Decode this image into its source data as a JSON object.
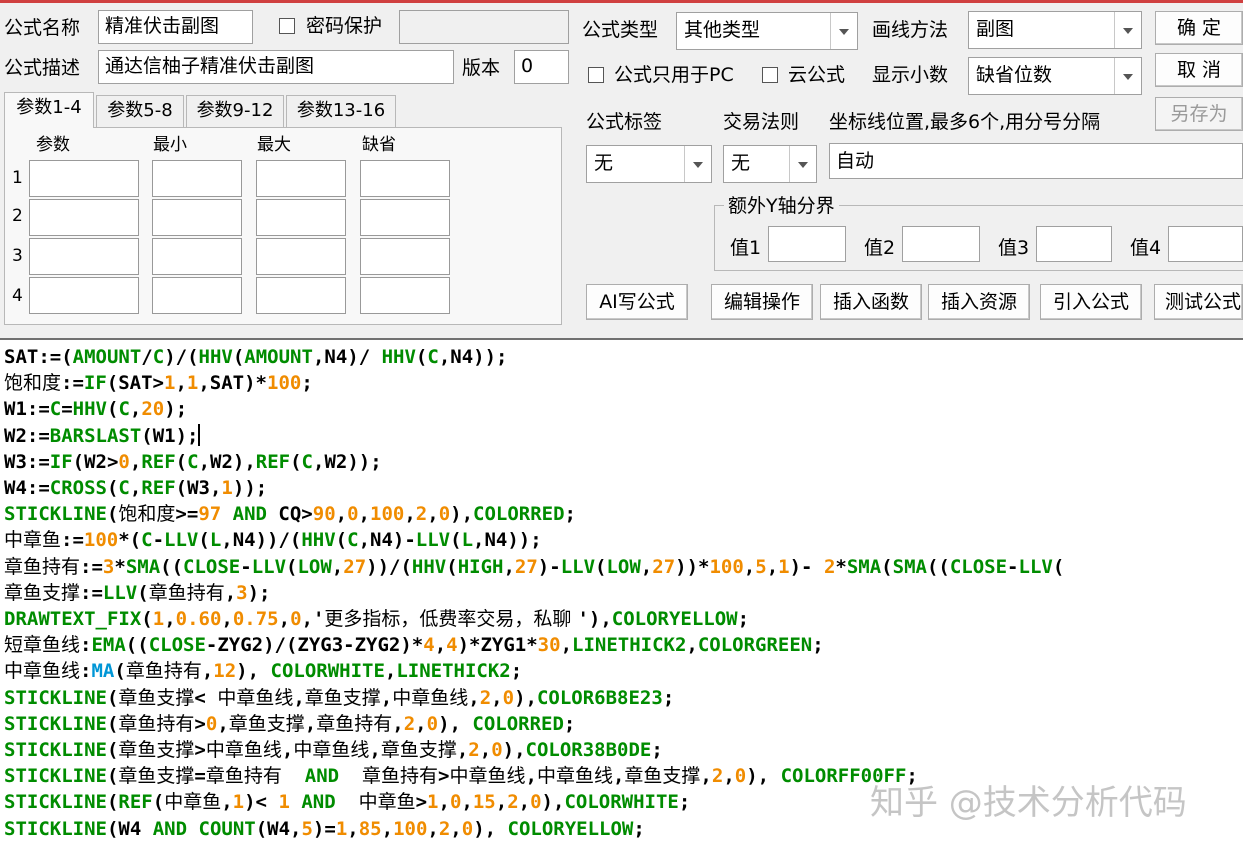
{
  "header": {
    "formula_name_label": "公式名称",
    "formula_name_value": "精准伏击副图",
    "password_label": "密码保护",
    "description_label": "公式描述",
    "description_value": "通达信柚子精准伏击副图",
    "version_label": "版本",
    "version_value": "0"
  },
  "right_panel": {
    "formula_type_label": "公式类型",
    "formula_type_value": "其他类型",
    "draw_method_label": "画线方法",
    "draw_method_value": "副图",
    "pc_only_label": "公式只用于PC",
    "cloud_label": "云公式",
    "decimals_label": "显示小数",
    "decimals_value": "缺省位数",
    "tag_label": "公式标签",
    "tag_value": "无",
    "trade_rule_label": "交易法则",
    "trade_rule_value": "无",
    "axis_label": "坐标线位置,最多6个,用分号分隔",
    "axis_value": "自动",
    "extra_y_label": "额外Y轴分界",
    "val1_label": "值1",
    "val2_label": "值2",
    "val3_label": "值3",
    "val4_label": "值4"
  },
  "buttons": {
    "ok": "确  定",
    "cancel": "取  消",
    "save_as": "另存为",
    "ai": "AI写公式",
    "edit": "编辑操作",
    "insert_func": "插入函数",
    "insert_res": "插入资源",
    "import": "引入公式",
    "test": "测试公式"
  },
  "param_tabs": [
    "参数1-4",
    "参数5-8",
    "参数9-12",
    "参数13-16"
  ],
  "param_headers": [
    "参数",
    "最小",
    "最大",
    "缺省"
  ],
  "param_rows": [
    "1",
    "2",
    "3",
    "4"
  ],
  "watermark": "知乎 @技术分析代码",
  "colors": {
    "keyword": "#000000",
    "function": "#008c00",
    "number": "#f08c00",
    "ma": "#0096d6"
  },
  "code_lines": [
    [
      [
        "k",
        "SAT:=("
      ],
      [
        "f",
        "AMOUNT"
      ],
      [
        "k",
        "/"
      ],
      [
        "f",
        "C"
      ],
      [
        "k",
        ")/("
      ],
      [
        "f",
        "HHV"
      ],
      [
        "k",
        "("
      ],
      [
        "f",
        "AMOUNT"
      ],
      [
        "k",
        ",N4)/ "
      ],
      [
        "f",
        "HHV"
      ],
      [
        "k",
        "("
      ],
      [
        "f",
        "C"
      ],
      [
        "k",
        ",N4));"
      ]
    ],
    [
      [
        "kc",
        "饱和度"
      ],
      [
        "k",
        ":="
      ],
      [
        "f",
        "IF"
      ],
      [
        "k",
        "(SAT>"
      ],
      [
        "n",
        "1"
      ],
      [
        "k",
        ","
      ],
      [
        "n",
        "1"
      ],
      [
        "k",
        ",SAT)*"
      ],
      [
        "n",
        "100"
      ],
      [
        "k",
        ";"
      ]
    ],
    [
      [
        "k",
        "W1:="
      ],
      [
        "f",
        "C"
      ],
      [
        "k",
        "="
      ],
      [
        "f",
        "HHV"
      ],
      [
        "k",
        "("
      ],
      [
        "f",
        "C"
      ],
      [
        "k",
        ","
      ],
      [
        "n",
        "20"
      ],
      [
        "k",
        ");"
      ]
    ],
    [
      [
        "k",
        "W2:="
      ],
      [
        "f",
        "BARSLAST"
      ],
      [
        "k",
        "(W1);"
      ]
    ],
    [
      [
        "k",
        "W3:="
      ],
      [
        "f",
        "IF"
      ],
      [
        "k",
        "(W2>"
      ],
      [
        "n",
        "0"
      ],
      [
        "k",
        ","
      ],
      [
        "f",
        "REF"
      ],
      [
        "k",
        "("
      ],
      [
        "f",
        "C"
      ],
      [
        "k",
        ",W2),"
      ],
      [
        "f",
        "REF"
      ],
      [
        "k",
        "("
      ],
      [
        "f",
        "C"
      ],
      [
        "k",
        ",W2));"
      ]
    ],
    [
      [
        "k",
        "W4:="
      ],
      [
        "f",
        "CROSS"
      ],
      [
        "k",
        "("
      ],
      [
        "f",
        "C"
      ],
      [
        "k",
        ","
      ],
      [
        "f",
        "REF"
      ],
      [
        "k",
        "(W3,"
      ],
      [
        "n",
        "1"
      ],
      [
        "k",
        "));"
      ]
    ],
    [
      [
        "f",
        "STICKLINE"
      ],
      [
        "k",
        "("
      ],
      [
        "kc",
        "饱和度"
      ],
      [
        "k",
        ">="
      ],
      [
        "n",
        "97"
      ],
      [
        "k",
        " "
      ],
      [
        "f",
        "AND"
      ],
      [
        "k",
        " CQ>"
      ],
      [
        "n",
        "90"
      ],
      [
        "k",
        ","
      ],
      [
        "n",
        "0"
      ],
      [
        "k",
        ","
      ],
      [
        "n",
        "100"
      ],
      [
        "k",
        ","
      ],
      [
        "n",
        "2"
      ],
      [
        "k",
        ","
      ],
      [
        "n",
        "0"
      ],
      [
        "k",
        "),"
      ],
      [
        "f",
        "COLORRED"
      ],
      [
        "k",
        ";"
      ]
    ],
    [
      [
        "kc",
        "中章鱼"
      ],
      [
        "k",
        ":="
      ],
      [
        "n",
        "100"
      ],
      [
        "k",
        "*("
      ],
      [
        "f",
        "C"
      ],
      [
        "k",
        "-"
      ],
      [
        "f",
        "LLV"
      ],
      [
        "k",
        "("
      ],
      [
        "f",
        "L"
      ],
      [
        "k",
        ",N4))/("
      ],
      [
        "f",
        "HHV"
      ],
      [
        "k",
        "("
      ],
      [
        "f",
        "C"
      ],
      [
        "k",
        ",N4)-"
      ],
      [
        "f",
        "LLV"
      ],
      [
        "k",
        "("
      ],
      [
        "f",
        "L"
      ],
      [
        "k",
        ",N4));"
      ]
    ],
    [
      [
        "kc",
        "章鱼持有"
      ],
      [
        "k",
        ":="
      ],
      [
        "n",
        "3"
      ],
      [
        "k",
        "*"
      ],
      [
        "f",
        "SMA"
      ],
      [
        "k",
        "(("
      ],
      [
        "f",
        "CLOSE"
      ],
      [
        "k",
        "-"
      ],
      [
        "f",
        "LLV"
      ],
      [
        "k",
        "("
      ],
      [
        "f",
        "LOW"
      ],
      [
        "k",
        ","
      ],
      [
        "n",
        "27"
      ],
      [
        "k",
        "))/("
      ],
      [
        "f",
        "HHV"
      ],
      [
        "k",
        "("
      ],
      [
        "f",
        "HIGH"
      ],
      [
        "k",
        ","
      ],
      [
        "n",
        "27"
      ],
      [
        "k",
        ")-"
      ],
      [
        "f",
        "LLV"
      ],
      [
        "k",
        "("
      ],
      [
        "f",
        "LOW"
      ],
      [
        "k",
        ","
      ],
      [
        "n",
        "27"
      ],
      [
        "k",
        "))*"
      ],
      [
        "n",
        "100"
      ],
      [
        "k",
        ","
      ],
      [
        "n",
        "5"
      ],
      [
        "k",
        ","
      ],
      [
        "n",
        "1"
      ],
      [
        "k",
        ")- "
      ],
      [
        "n",
        "2"
      ],
      [
        "k",
        "*"
      ],
      [
        "f",
        "SMA"
      ],
      [
        "k",
        "("
      ],
      [
        "f",
        "SMA"
      ],
      [
        "k",
        "(("
      ],
      [
        "f",
        "CLOSE"
      ],
      [
        "k",
        "-"
      ],
      [
        "f",
        "LLV"
      ],
      [
        "k",
        "("
      ]
    ],
    [
      [
        "kc",
        "章鱼支撑"
      ],
      [
        "k",
        ":="
      ],
      [
        "f",
        "LLV"
      ],
      [
        "k",
        "("
      ],
      [
        "kc",
        "章鱼持有"
      ],
      [
        "k",
        ","
      ],
      [
        "n",
        "3"
      ],
      [
        "k",
        ");"
      ]
    ],
    [
      [
        "f",
        "DRAWTEXT_FIX"
      ],
      [
        "k",
        "("
      ],
      [
        "n",
        "1"
      ],
      [
        "k",
        ","
      ],
      [
        "n",
        "0.60"
      ],
      [
        "k",
        ","
      ],
      [
        "n",
        "0.75"
      ],
      [
        "k",
        ","
      ],
      [
        "n",
        "0"
      ],
      [
        "k",
        ",'"
      ],
      [
        "kc",
        "更多指标，低费率交易，私聊 "
      ],
      [
        "k",
        "'),"
      ],
      [
        "f",
        "COLORYELLOW"
      ],
      [
        "k",
        ";"
      ]
    ],
    [
      [
        "kc",
        "短章鱼线"
      ],
      [
        "k",
        ":"
      ],
      [
        "f",
        "EMA"
      ],
      [
        "k",
        "(("
      ],
      [
        "f",
        "CLOSE"
      ],
      [
        "k",
        "-ZYG2)/(ZYG3-ZYG2)*"
      ],
      [
        "n",
        "4"
      ],
      [
        "k",
        ","
      ],
      [
        "n",
        "4"
      ],
      [
        "k",
        ")*ZYG1*"
      ],
      [
        "n",
        "30"
      ],
      [
        "k",
        ","
      ],
      [
        "f",
        "LINETHICK2"
      ],
      [
        "k",
        ","
      ],
      [
        "f",
        "COLORGREEN"
      ],
      [
        "k",
        ";"
      ]
    ],
    [
      [
        "kc",
        "中章鱼线"
      ],
      [
        "k",
        ":"
      ],
      [
        "m",
        "MA"
      ],
      [
        "k",
        "("
      ],
      [
        "kc",
        "章鱼持有"
      ],
      [
        "k",
        ","
      ],
      [
        "n",
        "12"
      ],
      [
        "k",
        "), "
      ],
      [
        "f",
        "COLORWHITE"
      ],
      [
        "k",
        ","
      ],
      [
        "f",
        "LINETHICK2"
      ],
      [
        "k",
        ";"
      ]
    ],
    [
      [
        "f",
        "STICKLINE"
      ],
      [
        "k",
        "("
      ],
      [
        "kc",
        "章鱼支撑"
      ],
      [
        "k",
        "< "
      ],
      [
        "kc",
        "中章鱼线"
      ],
      [
        "k",
        ","
      ],
      [
        "kc",
        "章鱼支撑"
      ],
      [
        "k",
        ","
      ],
      [
        "kc",
        "中章鱼线"
      ],
      [
        "k",
        ","
      ],
      [
        "n",
        "2"
      ],
      [
        "k",
        ","
      ],
      [
        "n",
        "0"
      ],
      [
        "k",
        "),"
      ],
      [
        "f",
        "COLOR6B8E23"
      ],
      [
        "k",
        ";"
      ]
    ],
    [
      [
        "f",
        "STICKLINE"
      ],
      [
        "k",
        "("
      ],
      [
        "kc",
        "章鱼持有"
      ],
      [
        "k",
        ">"
      ],
      [
        "n",
        "0"
      ],
      [
        "k",
        ","
      ],
      [
        "kc",
        "章鱼支撑"
      ],
      [
        "k",
        ","
      ],
      [
        "kc",
        "章鱼持有"
      ],
      [
        "k",
        ","
      ],
      [
        "n",
        "2"
      ],
      [
        "k",
        ","
      ],
      [
        "n",
        "0"
      ],
      [
        "k",
        "), "
      ],
      [
        "f",
        "COLORRED"
      ],
      [
        "k",
        ";"
      ]
    ],
    [
      [
        "f",
        "STICKLINE"
      ],
      [
        "k",
        "("
      ],
      [
        "kc",
        "章鱼支撑"
      ],
      [
        "k",
        ">"
      ],
      [
        "kc",
        "中章鱼线"
      ],
      [
        "k",
        ","
      ],
      [
        "kc",
        "中章鱼线"
      ],
      [
        "k",
        ","
      ],
      [
        "kc",
        "章鱼支撑"
      ],
      [
        "k",
        ","
      ],
      [
        "n",
        "2"
      ],
      [
        "k",
        ","
      ],
      [
        "n",
        "0"
      ],
      [
        "k",
        "),"
      ],
      [
        "f",
        "COLOR38B0DE"
      ],
      [
        "k",
        ";"
      ]
    ],
    [
      [
        "f",
        "STICKLINE"
      ],
      [
        "k",
        "("
      ],
      [
        "kc",
        "章鱼支撑"
      ],
      [
        "k",
        "="
      ],
      [
        "kc",
        "章鱼持有"
      ],
      [
        "k",
        "  "
      ],
      [
        "f",
        "AND"
      ],
      [
        "k",
        "  "
      ],
      [
        "kc",
        "章鱼持有"
      ],
      [
        "k",
        ">"
      ],
      [
        "kc",
        "中章鱼线"
      ],
      [
        "k",
        ","
      ],
      [
        "kc",
        "中章鱼线"
      ],
      [
        "k",
        ","
      ],
      [
        "kc",
        "章鱼支撑"
      ],
      [
        "k",
        ","
      ],
      [
        "n",
        "2"
      ],
      [
        "k",
        ","
      ],
      [
        "n",
        "0"
      ],
      [
        "k",
        "), "
      ],
      [
        "f",
        "COLORFF00FF"
      ],
      [
        "k",
        ";"
      ]
    ],
    [
      [
        "f",
        "STICKLINE"
      ],
      [
        "k",
        "("
      ],
      [
        "f",
        "REF"
      ],
      [
        "k",
        "("
      ],
      [
        "kc",
        "中章鱼"
      ],
      [
        "k",
        ","
      ],
      [
        "n",
        "1"
      ],
      [
        "k",
        ")< "
      ],
      [
        "n",
        "1"
      ],
      [
        "k",
        " "
      ],
      [
        "f",
        "AND"
      ],
      [
        "k",
        "  "
      ],
      [
        "kc",
        "中章鱼"
      ],
      [
        "k",
        ">"
      ],
      [
        "n",
        "1"
      ],
      [
        "k",
        ","
      ],
      [
        "n",
        "0"
      ],
      [
        "k",
        ","
      ],
      [
        "n",
        "15"
      ],
      [
        "k",
        ","
      ],
      [
        "n",
        "2"
      ],
      [
        "k",
        ","
      ],
      [
        "n",
        "0"
      ],
      [
        "k",
        "),"
      ],
      [
        "f",
        "COLORWHITE"
      ],
      [
        "k",
        ";"
      ]
    ],
    [
      [
        "f",
        "STICKLINE"
      ],
      [
        "k",
        "(W4 "
      ],
      [
        "f",
        "AND"
      ],
      [
        "k",
        " "
      ],
      [
        "f",
        "COUNT"
      ],
      [
        "k",
        "(W4,"
      ],
      [
        "n",
        "5"
      ],
      [
        "k",
        ")="
      ],
      [
        "n",
        "1"
      ],
      [
        "k",
        ","
      ],
      [
        "n",
        "85"
      ],
      [
        "k",
        ","
      ],
      [
        "n",
        "100"
      ],
      [
        "k",
        ","
      ],
      [
        "n",
        "2"
      ],
      [
        "k",
        ","
      ],
      [
        "n",
        "0"
      ],
      [
        "k",
        "), "
      ],
      [
        "f",
        "COLORYELLOW"
      ],
      [
        "k",
        ";"
      ]
    ]
  ]
}
